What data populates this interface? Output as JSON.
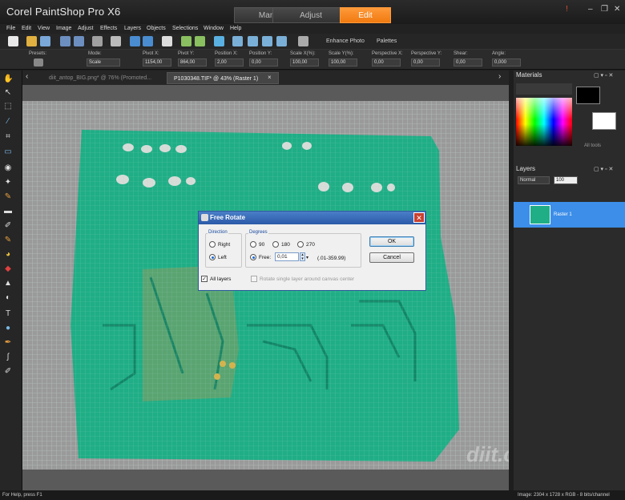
{
  "app": {
    "title": "Corel PaintShop Pro X6"
  },
  "workspace_tabs": [
    {
      "label": "Manage"
    },
    {
      "label": "Adjust"
    },
    {
      "label": "Edit"
    }
  ],
  "window_controls": {
    "alert": "!",
    "minimize": "–",
    "restore": "❐",
    "close": "✕"
  },
  "menu": [
    "File",
    "Edit",
    "View",
    "Image",
    "Adjust",
    "Effects",
    "Layers",
    "Objects",
    "Selections",
    "Window",
    "Help"
  ],
  "toolbar": {
    "enhance_photo": "Enhance Photo",
    "palettes": "Palettes"
  },
  "options": {
    "presets": "Presets:",
    "mode_label": "Mode:",
    "mode_value": "Scale",
    "pivot_x_label": "Pivot X:",
    "pivot_x": "1154,00",
    "pivot_y_label": "Pivot Y:",
    "pivot_y": "864,00",
    "position_x_label": "Position X:",
    "position_x": "2,00",
    "position_y_label": "Position Y:",
    "position_y": "0,00",
    "scale_x_label": "Scale X(%):",
    "scale_x": "100,00",
    "scale_y_label": "Scale Y(%):",
    "scale_y": "100,00",
    "persp_x_label": "Perspective X:",
    "persp_x": "0,00",
    "persp_y_label": "Perspective Y:",
    "persp_y": "0,00",
    "shear_label": "Shear:",
    "shear": "0,00",
    "angle_label": "Angle:",
    "angle": "0,000"
  },
  "doc_tabs": [
    {
      "label": "diit_antop_BIG.png* @ 76% (Promoted..."
    },
    {
      "label": "P1030348.TIF* @ 43% (Raster 1)"
    }
  ],
  "panels": {
    "materials": {
      "title": "Materials",
      "all_tools": "All tools"
    },
    "layers": {
      "title": "Layers",
      "blend": "Normal",
      "opacity": "100",
      "layer_name": "Raster 1"
    }
  },
  "status": {
    "help": "For Help, press F1",
    "image_info": "Image:  2304 x 1728 x RGB - 8 bits/channel"
  },
  "dialog": {
    "title": "Free Rotate",
    "direction_label": "Direction",
    "right": "Right",
    "left": "Left",
    "degrees_label": "Degrees",
    "d90": "90",
    "d180": "180",
    "d270": "270",
    "free": "Free:",
    "free_value": "0,01",
    "range": "(.01-359.99)",
    "ok": "OK",
    "cancel": "Cancel",
    "all_layers": "All layers",
    "rotate_single": "Rotate single layer around canvas center"
  },
  "watermark": "diit.cz",
  "colors": {
    "accent": "#f07a10",
    "pcb": "#1fae86",
    "dialog_title": "#2b5aa8",
    "selected_layer": "#3c8ee8"
  }
}
